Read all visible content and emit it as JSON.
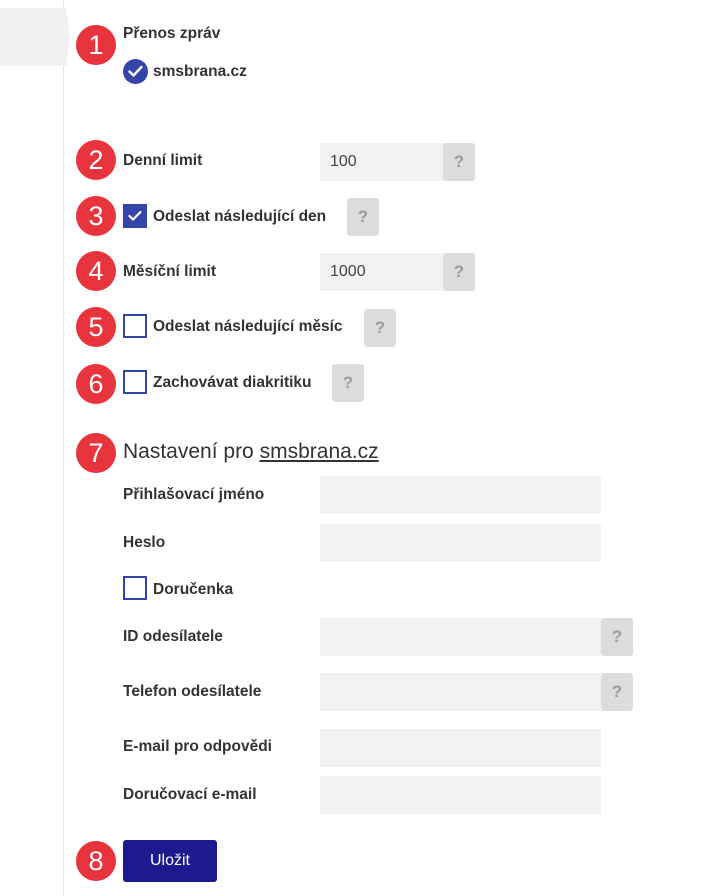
{
  "steps": [
    "1",
    "2",
    "3",
    "4",
    "5",
    "6",
    "7",
    "8"
  ],
  "transfer": {
    "title": "Přenos zpráv",
    "provider_label": "smsbrana.cz"
  },
  "daily_limit": {
    "label": "Denní limit",
    "value": "100",
    "help": "?"
  },
  "send_next_day": {
    "label": "Odeslat následující den",
    "checked": true,
    "help": "?"
  },
  "monthly_limit": {
    "label": "Měsíční limit",
    "value": "1000",
    "help": "?"
  },
  "send_next_month": {
    "label": "Odeslat následující měsíc",
    "checked": false,
    "help": "?"
  },
  "keep_diacritics": {
    "label": "Zachovávat diakritiku",
    "checked": false,
    "help": "?"
  },
  "settings": {
    "title_prefix": "Nastavení pro",
    "title_link": "smsbrana.cz",
    "login_label": "Přihlašovací jméno",
    "login_value": "",
    "password_label": "Heslo",
    "password_value": "",
    "receipt_label": "Doručenka",
    "receipt_checked": false,
    "sender_id_label": "ID odesílatele",
    "sender_id_value": "",
    "sender_id_help": "?",
    "sender_phone_label": "Telefon odesílatele",
    "sender_phone_value": "",
    "sender_phone_help": "?",
    "reply_email_label": "E-mail pro odpovědi",
    "reply_email_value": "",
    "delivery_email_label": "Doručovací e-mail",
    "delivery_email_value": ""
  },
  "save_label": "Uložit",
  "colors": {
    "badge": "#e8343d",
    "checkbox": "#3444a8",
    "button": "#1b1a8e",
    "field_bg": "#f2f2f2",
    "help_bg": "#dcdcdc"
  }
}
